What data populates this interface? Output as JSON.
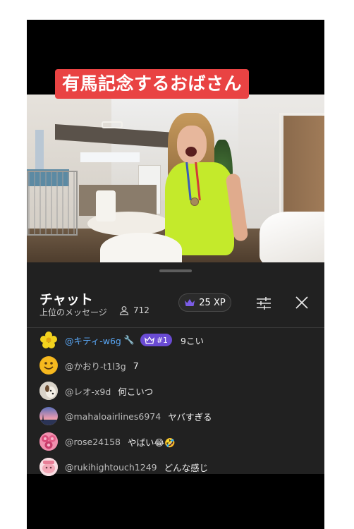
{
  "video": {
    "caption": "有馬記念するおばさん"
  },
  "chat": {
    "title": "チャット",
    "subtitle": "上位のメッセージ",
    "viewer_count": "712",
    "xp_label": "25 XP",
    "accent_color": "#6a4bd4",
    "highlight_username_color": "#5aa8f7",
    "icons": {
      "viewers": "person-icon",
      "xp": "crown-icon",
      "filter": "sliders-icon",
      "close": "close-icon",
      "wrench": "wrench-icon"
    },
    "messages": [
      {
        "username": "@キティ-w6g",
        "badge": "#1",
        "text": "9こい",
        "avatar": "flower"
      },
      {
        "username": "@かおり-t1l3g",
        "text": "7",
        "avatar": "smiley"
      },
      {
        "username": "@レオ-x9d",
        "text": "何こいつ",
        "avatar": "dog"
      },
      {
        "username": "@mahaloairlines6974",
        "text": "ヤバすぎる",
        "avatar": "sunset"
      },
      {
        "username": "@rose24158",
        "text": "やばい😂🤣",
        "avatar": "roses"
      },
      {
        "username": "@rukihightouch1249",
        "text": "どんな感じ",
        "avatar": "pink"
      }
    ]
  }
}
